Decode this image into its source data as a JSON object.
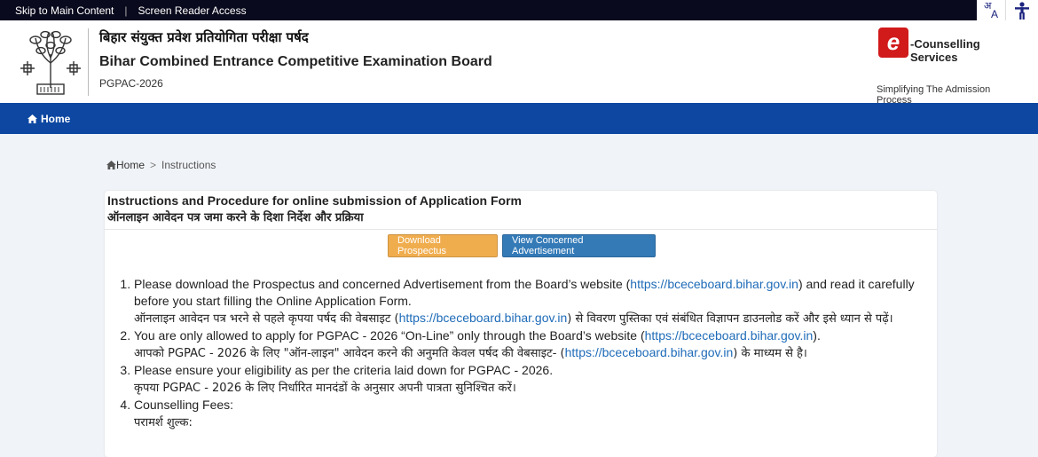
{
  "topbar": {
    "skip_label": "Skip to Main Content",
    "separator": "|",
    "screen_reader_label": "Screen Reader Access",
    "font_icon_hi": "अ",
    "font_icon_en": "A"
  },
  "header": {
    "title_hi": "बिहार संयुक्त प्रवेश प्रतियोगिता परीक्षा पर्षद",
    "title_en": "Bihar Combined Entrance Competitive Examination Board",
    "code": "PGPAC-2026",
    "ecounselling": {
      "logo_letter": "e",
      "title": "-Counselling Services",
      "tagline": "Simplifying The Admission Process"
    }
  },
  "nav": {
    "home_label": "Home"
  },
  "breadcrumb": {
    "home": "Home",
    "sep": ">",
    "current": "Instructions"
  },
  "card": {
    "title_en": "Instructions and Procedure for online submission of Application Form",
    "title_hi": "ऑनलाइन आवेदन पत्र जमा करने के दिशा निर्देश और प्रक्रिया",
    "download_label": "Download Prospectus",
    "advert_label": "View Concerned Advertisement"
  },
  "items": {
    "i1": {
      "en_a": "Please download the Prospectus and concerned Advertisement from the Board’s website (",
      "link": "https://bceceboard.bihar.gov.in",
      "en_b": ") and read it carefully before you start filling the Online Application Form.",
      "hi_a": "ऑनलाइन आवेदन पत्र भरने से पहले कृपया पर्षद की वेबसाइट (",
      "hi_b": ") से विवरण पुस्तिका एवं संबंधित विज्ञापन डाउनलोड करें और इसे ध्यान से पढ़ें।"
    },
    "i2": {
      "en_a": "You are only allowed to apply for PGPAC - 2026 “On-Line” only through the Board’s website (",
      "link": "https://bceceboard.bihar.gov.in",
      "en_b": ").",
      "hi_a": "आपको PGPAC - 2026 के लिए \"ऑन-लाइन\" आवेदन करने की अनुमति केवल पर्षद की वेबसाइट- (",
      "hi_b": ") के माध्यम से है।"
    },
    "i3": {
      "en": "Please ensure your eligibility as per the criteria laid down for PGPAC - 2026.",
      "hi": "कृपया PGPAC - 2026 के लिए निर्धारित मानदंडों के अनुसार अपनी पात्रता सुनिश्चित करें।"
    },
    "i4": {
      "en": "Counselling Fees:",
      "hi": "परामर्श शुल्क:"
    }
  }
}
